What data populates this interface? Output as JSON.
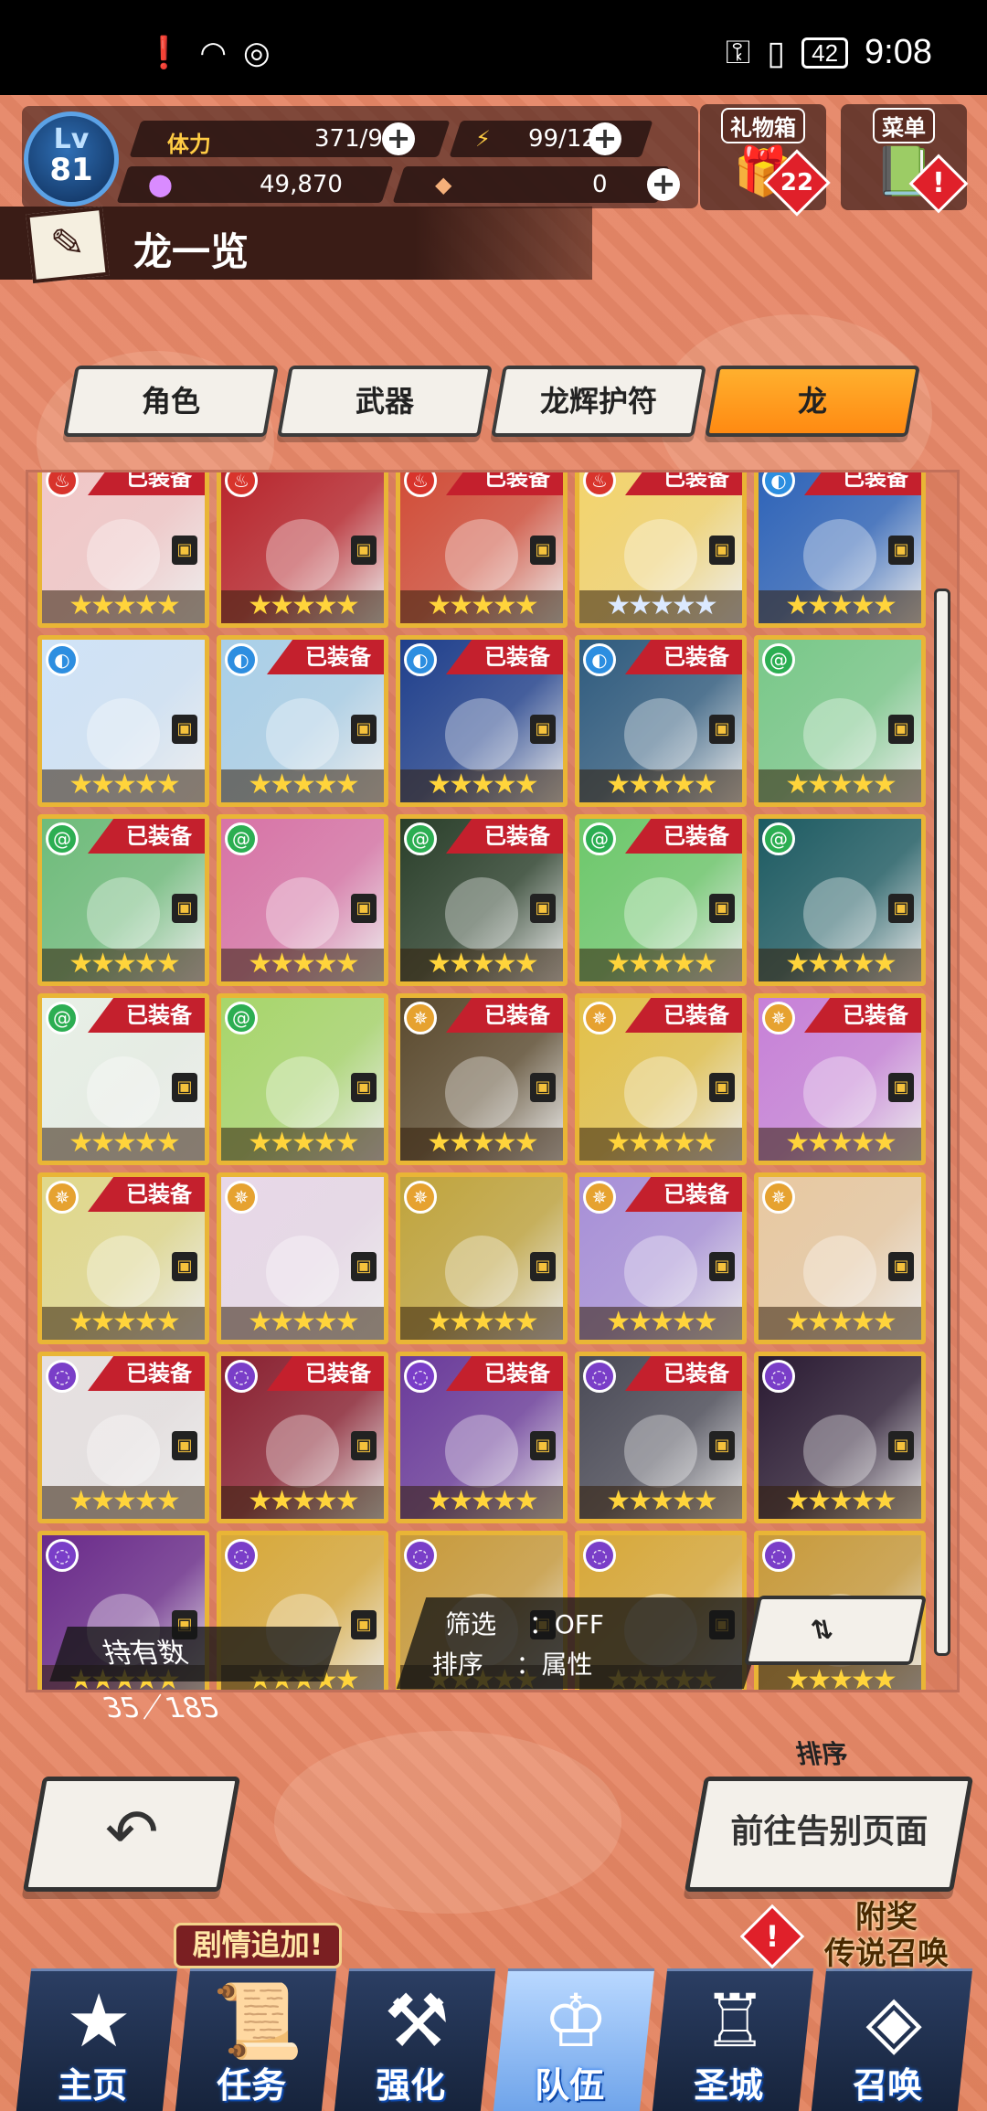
{
  "status_bar": {
    "left_icons": [
      "alert-icon",
      "wifi-icon",
      "sync-icon"
    ],
    "battery": "42",
    "time": "9:08"
  },
  "hud": {
    "level_label": "Lv",
    "level": "81",
    "stamina_label": "体力",
    "stamina": "371/90",
    "energy": "99/12",
    "currency": "49,870",
    "gems": "0",
    "gift_label": "礼物箱",
    "gift_count": "22",
    "menu_label": "菜单",
    "menu_alert": "!"
  },
  "title": "龙一览",
  "tabs": [
    {
      "label": "角色",
      "active": false
    },
    {
      "label": "武器",
      "active": false
    },
    {
      "label": "龙辉护符",
      "active": false
    },
    {
      "label": "龙",
      "active": true
    }
  ],
  "equipped_label": "已装备",
  "cards": [
    {
      "elem": "fire",
      "equipped": true,
      "color": "#f2c7c7",
      "stars": 5
    },
    {
      "elem": "fire",
      "equipped": false,
      "color": "#b8232a",
      "stars": 5
    },
    {
      "elem": "fire",
      "equipped": true,
      "color": "#d14b36",
      "stars": 5
    },
    {
      "elem": "fire",
      "equipped": true,
      "color": "#f3d36a",
      "stars": 5,
      "blue_stars": true
    },
    {
      "elem": "water",
      "equipped": true,
      "color": "#2c62b8",
      "stars": 5
    },
    {
      "elem": "water",
      "equipped": false,
      "color": "#cfe3f7",
      "stars": 5
    },
    {
      "elem": "water",
      "equipped": true,
      "color": "#a9cfe8",
      "stars": 5
    },
    {
      "elem": "water",
      "equipped": true,
      "color": "#1f3f8c",
      "stars": 5
    },
    {
      "elem": "water",
      "equipped": true,
      "color": "#2f5b7e",
      "stars": 5
    },
    {
      "elem": "wind",
      "equipped": false,
      "color": "#78c888",
      "stars": 5
    },
    {
      "elem": "wind",
      "equipped": true,
      "color": "#6ebc7a",
      "stars": 5
    },
    {
      "elem": "wind",
      "equipped": false,
      "color": "#d873a6",
      "stars": 5
    },
    {
      "elem": "wind",
      "equipped": true,
      "color": "#2a3f2a",
      "stars": 5
    },
    {
      "elem": "wind",
      "equipped": true,
      "color": "#6cc86a",
      "stars": 5
    },
    {
      "elem": "wind",
      "equipped": false,
      "color": "#1d5b62",
      "stars": 5
    },
    {
      "elem": "wind",
      "equipped": true,
      "color": "#e8f0e6",
      "stars": 5
    },
    {
      "elem": "wind",
      "equipped": false,
      "color": "#a7d66a",
      "stars": 5
    },
    {
      "elem": "light",
      "equipped": true,
      "color": "#5b4a2e",
      "stars": 5
    },
    {
      "elem": "light",
      "equipped": true,
      "color": "#e2c048",
      "stars": 5
    },
    {
      "elem": "light",
      "equipped": true,
      "color": "#c780d8",
      "stars": 5
    },
    {
      "elem": "light",
      "equipped": true,
      "color": "#e0d88a",
      "stars": 5
    },
    {
      "elem": "light",
      "equipped": false,
      "color": "#e8d8e8",
      "stars": 5
    },
    {
      "elem": "light",
      "equipped": false,
      "color": "#c0a43c",
      "stars": 5
    },
    {
      "elem": "light",
      "equipped": true,
      "color": "#a78fd8",
      "stars": 5
    },
    {
      "elem": "light",
      "equipped": false,
      "color": "#e8c8a0",
      "stars": 5
    },
    {
      "elem": "dark",
      "equipped": true,
      "color": "#e6e0e0",
      "stars": 5
    },
    {
      "elem": "dark",
      "equipped": true,
      "color": "#8a2030",
      "stars": 5
    },
    {
      "elem": "dark",
      "equipped": true,
      "color": "#6a3a9a",
      "stars": 5
    },
    {
      "elem": "dark",
      "equipped": true,
      "color": "#4a4a56",
      "stars": 5
    },
    {
      "elem": "dark",
      "equipped": false,
      "color": "#2a1a32",
      "stars": 5
    },
    {
      "elem": "dark",
      "equipped": false,
      "color": "#6a2a8a",
      "stars": 5
    },
    {
      "elem": "dark",
      "equipped": false,
      "color": "#d8a838",
      "stars": 5
    },
    {
      "elem": "dark",
      "equipped": false,
      "color": "#c89a3a",
      "stars": 5
    },
    {
      "elem": "dark",
      "equipped": false,
      "color": "#d8a838",
      "stars": 5
    },
    {
      "elem": "dark",
      "equipped": false,
      "color": "#c89a3a",
      "stars": 5
    }
  ],
  "element_colors": {
    "fire": "#d8342c",
    "water": "#2d8ee0",
    "wind": "#2cae52",
    "light": "#e6a230",
    "dark": "#7a3ec8"
  },
  "hold": {
    "label": "持有数",
    "value": "35／185"
  },
  "filter": {
    "filter_label": "筛选",
    "filter_value": "：OFF",
    "sort_label": "排序",
    "sort_value": "：属性"
  },
  "sort_button": "排序",
  "back_button_icon": "back-arrow-icon",
  "farewell_button": "前往告别页面",
  "story_tag": "剧情追加!",
  "summon_tag": "附奖\n传说召唤",
  "nav": [
    {
      "label": "主页",
      "icon": "home-icon"
    },
    {
      "label": "任务",
      "icon": "quest-icon"
    },
    {
      "label": "强化",
      "icon": "hammer-icon"
    },
    {
      "label": "队伍",
      "icon": "party-icon",
      "active": true
    },
    {
      "label": "圣城",
      "icon": "castle-icon"
    },
    {
      "label": "召唤",
      "icon": "crystal-icon"
    }
  ]
}
